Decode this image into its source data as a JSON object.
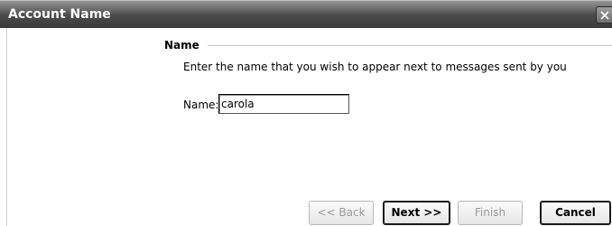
{
  "window": {
    "title": "Account Name"
  },
  "section": {
    "title": "Name",
    "instructions": "Enter the name that you wish to appear next to messages sent by you"
  },
  "form": {
    "name_label": "Name:",
    "name_value": "carola"
  },
  "buttons": {
    "back": "<< Back",
    "next": "Next >>",
    "finish": "Finish",
    "cancel": "Cancel"
  },
  "icons": {
    "close": "close-icon"
  },
  "colors": {
    "titlebar": "#4b4b4b",
    "title_text": "#ffffff",
    "background": "#ffffff",
    "disabled_text": "#9a9a9a"
  }
}
